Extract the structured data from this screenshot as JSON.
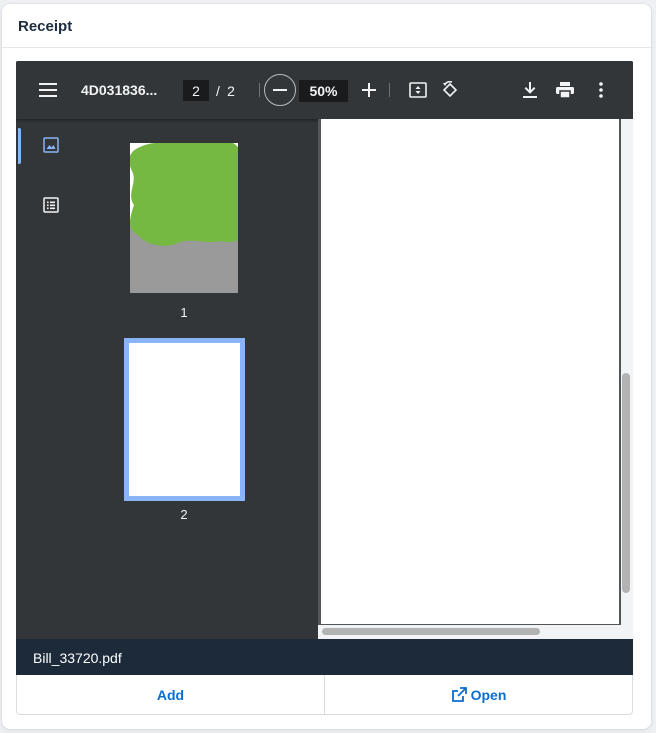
{
  "panel": {
    "title": "Receipt"
  },
  "viewer": {
    "doc_title": "4D031836...",
    "current_page": "2",
    "page_separator": "/",
    "total_pages": "2",
    "zoom": "50%",
    "thumbnails": [
      {
        "label": "1"
      },
      {
        "label": "2"
      }
    ]
  },
  "file": {
    "name": "Bill_33720.pdf"
  },
  "actions": {
    "add_label": "Add",
    "open_label": "Open"
  },
  "icons": {
    "menu": "menu-icon",
    "zoom_out": "minus-icon",
    "zoom_in": "plus-icon",
    "fit": "fit-page-icon",
    "rotate": "rotate-icon",
    "download": "download-icon",
    "print": "print-icon",
    "more": "more-vert-icon",
    "thumbnails": "image-icon",
    "outline": "list-icon",
    "open": "external-link-icon"
  },
  "colors": {
    "accent": "#0a6ed1",
    "viewer_bg": "#323639",
    "file_bar": "#1c2a3a",
    "selection": "#8ab4f8",
    "redaction": "#76b942"
  }
}
